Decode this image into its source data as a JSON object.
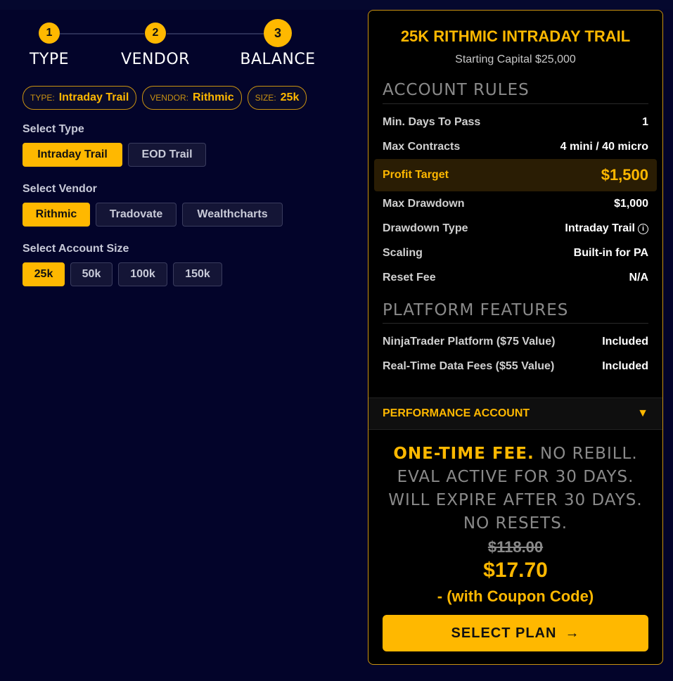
{
  "steps": [
    {
      "number": "1",
      "label": "TYPE"
    },
    {
      "number": "2",
      "label": "VENDOR"
    },
    {
      "number": "3",
      "label": "BALANCE"
    }
  ],
  "summary": {
    "type_key": "TYPE:",
    "type_val": "Intraday Trail",
    "vendor_key": "VENDOR:",
    "vendor_val": "Rithmic",
    "size_key": "SIZE:",
    "size_val": "25k"
  },
  "select_type": {
    "label": "Select Type",
    "options": [
      "Intraday Trail",
      "EOD Trail"
    ],
    "selected": "Intraday Trail"
  },
  "select_vendor": {
    "label": "Select Vendor",
    "options": [
      "Rithmic",
      "Tradovate",
      "Wealthcharts"
    ],
    "selected": "Rithmic"
  },
  "select_size": {
    "label": "Select Account Size",
    "options": [
      "25k",
      "50k",
      "100k",
      "150k"
    ],
    "selected": "25k"
  },
  "card": {
    "title": "25K RITHMIC INTRADAY TRAIL",
    "subtitle": "Starting Capital $25,000",
    "rules_heading": "ACCOUNT RULES",
    "rules": [
      {
        "k": "Min. Days To Pass",
        "v": "1"
      },
      {
        "k": "Max Contracts",
        "v": "4 mini / 40 micro"
      },
      {
        "k": "Profit Target",
        "v": "$1,500"
      },
      {
        "k": "Max Drawdown",
        "v": "$1,000"
      },
      {
        "k": "Drawdown Type",
        "v": "Intraday Trail"
      },
      {
        "k": "Scaling",
        "v": "Built-in for PA"
      },
      {
        "k": "Reset Fee",
        "v": "N/A"
      }
    ],
    "features_heading": "PLATFORM FEATURES",
    "features": [
      {
        "k": "NinjaTrader Platform ($75 Value)",
        "v": "Included"
      },
      {
        "k": "Real-Time Data Fees ($55 Value)",
        "v": "Included"
      }
    ],
    "perf_label": "PERFORMANCE ACCOUNT",
    "perf_arrow": "▼",
    "fee_highlight": "ONE-TIME FEE.",
    "fee_rest1": "NO REBILL.",
    "fee_line2": "EVAL ACTIVE FOR 30 DAYS.",
    "fee_line3": "WILL EXPIRE AFTER 30 DAYS. NO RESETS.",
    "old_price": "$118.00",
    "new_price": "$17.70",
    "coupon_note": "- (with Coupon Code)",
    "select_label": "SELECT PLAN",
    "select_arrow": "→"
  },
  "colors": {
    "accent": "#ffb800",
    "background": "#03042a",
    "card_bg": "#000000"
  }
}
